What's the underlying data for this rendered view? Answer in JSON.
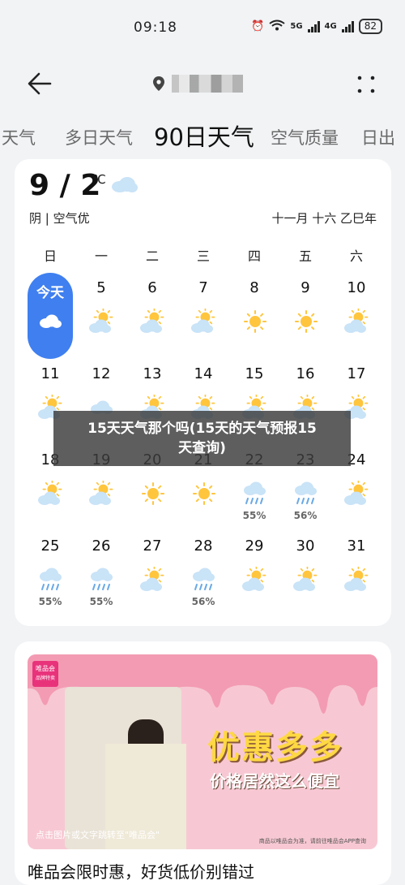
{
  "status": {
    "time": "09:18",
    "signal1": "5G",
    "signal2": "4G",
    "battery": "82"
  },
  "header": {
    "back_icon": "back-arrow-icon",
    "location_icon": "location-pin-icon",
    "more_icon": "more-dots-icon"
  },
  "tabs": [
    {
      "label": "天气"
    },
    {
      "label": "多日天气"
    },
    {
      "label": "90日天气"
    },
    {
      "label": "空气质量"
    },
    {
      "label": "日出"
    }
  ],
  "today": {
    "temp": "9 / 2",
    "unit": "℃",
    "condition": "阴 | 空气优",
    "lunar": "十一月 十六 乙巳年"
  },
  "weekdays": [
    "日",
    "一",
    "二",
    "三",
    "四",
    "五",
    "六"
  ],
  "calendar": [
    {
      "d": "今天",
      "icon": "cloudy-icon",
      "pct": ""
    },
    {
      "d": "5",
      "icon": "partly-cloudy-icon",
      "pct": ""
    },
    {
      "d": "6",
      "icon": "partly-cloudy-icon",
      "pct": ""
    },
    {
      "d": "7",
      "icon": "partly-cloudy-icon",
      "pct": ""
    },
    {
      "d": "8",
      "icon": "sunny-icon",
      "pct": ""
    },
    {
      "d": "9",
      "icon": "sunny-icon",
      "pct": ""
    },
    {
      "d": "10",
      "icon": "partly-cloudy-icon",
      "pct": ""
    },
    {
      "d": "11",
      "icon": "partly-cloudy-icon",
      "pct": ""
    },
    {
      "d": "12",
      "icon": "cloudy-icon",
      "pct": ""
    },
    {
      "d": "13",
      "icon": "partly-cloudy-icon",
      "pct": ""
    },
    {
      "d": "14",
      "icon": "partly-cloudy-icon",
      "pct": ""
    },
    {
      "d": "15",
      "icon": "partly-cloudy-icon",
      "pct": ""
    },
    {
      "d": "16",
      "icon": "partly-cloudy-icon",
      "pct": ""
    },
    {
      "d": "17",
      "icon": "partly-cloudy-icon",
      "pct": ""
    },
    {
      "d": "18",
      "icon": "partly-cloudy-icon",
      "pct": ""
    },
    {
      "d": "19",
      "icon": "partly-cloudy-icon",
      "pct": ""
    },
    {
      "d": "20",
      "icon": "sunny-icon",
      "pct": ""
    },
    {
      "d": "21",
      "icon": "sunny-icon",
      "pct": ""
    },
    {
      "d": "22",
      "icon": "rain-icon",
      "pct": "55%"
    },
    {
      "d": "23",
      "icon": "rain-icon",
      "pct": "56%"
    },
    {
      "d": "24",
      "icon": "partly-cloudy-icon",
      "pct": ""
    },
    {
      "d": "25",
      "icon": "rain-icon",
      "pct": "55%"
    },
    {
      "d": "26",
      "icon": "rain-icon",
      "pct": "55%"
    },
    {
      "d": "27",
      "icon": "partly-cloudy-icon",
      "pct": ""
    },
    {
      "d": "28",
      "icon": "rain-icon",
      "pct": "56%"
    },
    {
      "d": "29",
      "icon": "partly-cloudy-icon",
      "pct": ""
    },
    {
      "d": "30",
      "icon": "partly-cloudy-icon",
      "pct": ""
    },
    {
      "d": "31",
      "icon": "partly-cloudy-icon",
      "pct": ""
    }
  ],
  "overlay": {
    "line1": "15天天气那个吗(15天的天气预报15",
    "line2": "天查询)"
  },
  "ad": {
    "brand": "唯品会",
    "brand_sub": "品牌特卖",
    "headline": "优惠多多",
    "subline": "价格居然这么便宜",
    "note": "点击图片或文字跳转至\"唯品会\"",
    "note2": "商品以唯品会为准，请前往唯品会APP查询",
    "title": "唯品会限时惠，好货低价别错过"
  },
  "colors": {
    "accent": "#3f7ff0",
    "sun": "#ffc53d",
    "cloud": "#c9e3f7"
  }
}
